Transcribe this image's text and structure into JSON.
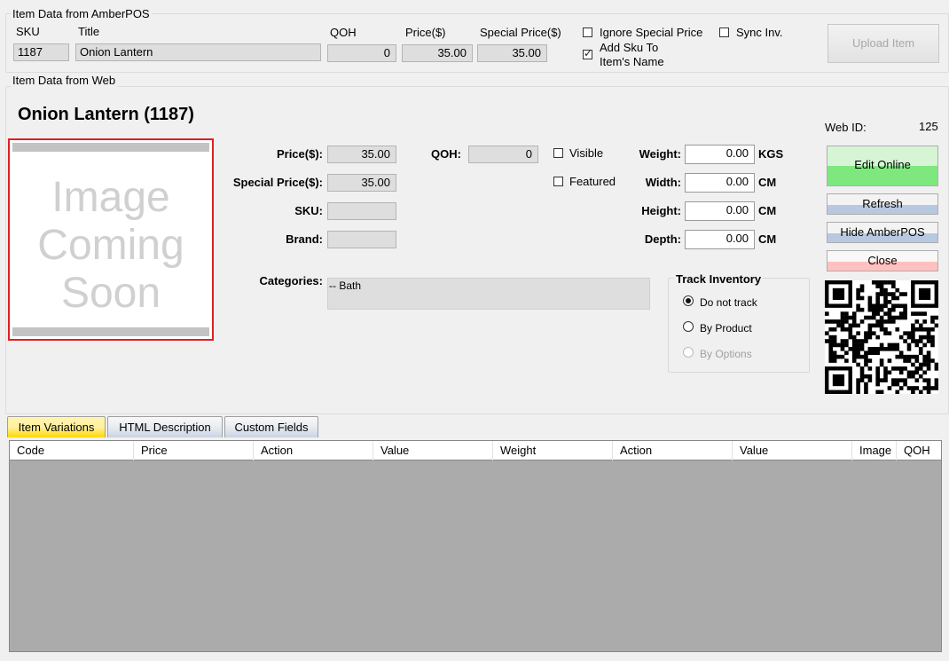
{
  "amberpos": {
    "group_title": "Item Data from AmberPOS",
    "sku_label": "SKU",
    "sku_value": "1187",
    "title_label": "Title",
    "title_value": "Onion Lantern",
    "qoh_label": "QOH",
    "qoh_value": "0",
    "price_label": "Price($)",
    "price_value": "35.00",
    "special_label": "Special Price($)",
    "special_value": "35.00",
    "ignore_special_label": "Ignore Special Price",
    "ignore_special_checked": false,
    "sync_inv_label": "Sync Inv.",
    "sync_inv_checked": false,
    "add_sku_label_1": "Add Sku To",
    "add_sku_label_2": "Item's Name",
    "add_sku_checked": true,
    "upload_button": "Upload Item"
  },
  "web": {
    "group_title": "Item Data from Web",
    "item_heading": "Onion Lantern (1187)",
    "image_placeholder": [
      "Image",
      "Coming",
      "Soon"
    ],
    "price_label": "Price($):",
    "price_value": "35.00",
    "special_label": "Special Price($):",
    "special_value": "35.00",
    "sku_label": "SKU:",
    "sku_value": "",
    "brand_label": "Brand:",
    "brand_value": "",
    "qoh_label": "QOH:",
    "qoh_value": "0",
    "visible_label": "Visible",
    "visible_checked": false,
    "featured_label": "Featured",
    "featured_checked": false,
    "weight_label": "Weight:",
    "weight_value": "0.00",
    "weight_unit": "KGS",
    "width_label": "Width:",
    "width_value": "0.00",
    "width_unit": "CM",
    "height_label": "Height:",
    "height_value": "0.00",
    "height_unit": "CM",
    "depth_label": "Depth:",
    "depth_value": "0.00",
    "depth_unit": "CM",
    "categories_label": "Categories:",
    "categories_value": "-- Bath",
    "web_id_label": "Web ID:",
    "web_id_value": "125",
    "track_inventory": {
      "title": "Track Inventory",
      "options": [
        {
          "label": "Do not track",
          "selected": true,
          "disabled": false
        },
        {
          "label": "By Product",
          "selected": false,
          "disabled": false
        },
        {
          "label": "By Options",
          "selected": false,
          "disabled": true
        }
      ]
    },
    "buttons": {
      "edit_online": "Edit Online",
      "refresh": "Refresh",
      "hide_amberpos": "Hide AmberPOS",
      "close": "Close"
    },
    "colors": {
      "edit_online_top": "#d5f5d5",
      "edit_online_bottom": "#7ee87e",
      "refresh_bar": "#b8c8e0",
      "close_bar": "#ffc0c0",
      "image_border": "#e02020"
    }
  },
  "tabs": [
    {
      "label": "Item Variations",
      "active": true
    },
    {
      "label": "HTML Description",
      "active": false
    },
    {
      "label": "Custom Fields",
      "active": false
    }
  ],
  "grid": {
    "columns": [
      "Code",
      "Price",
      "Action",
      "Value",
      "Weight",
      "Action",
      "Value",
      "Image",
      "QOH"
    ],
    "rows": []
  }
}
